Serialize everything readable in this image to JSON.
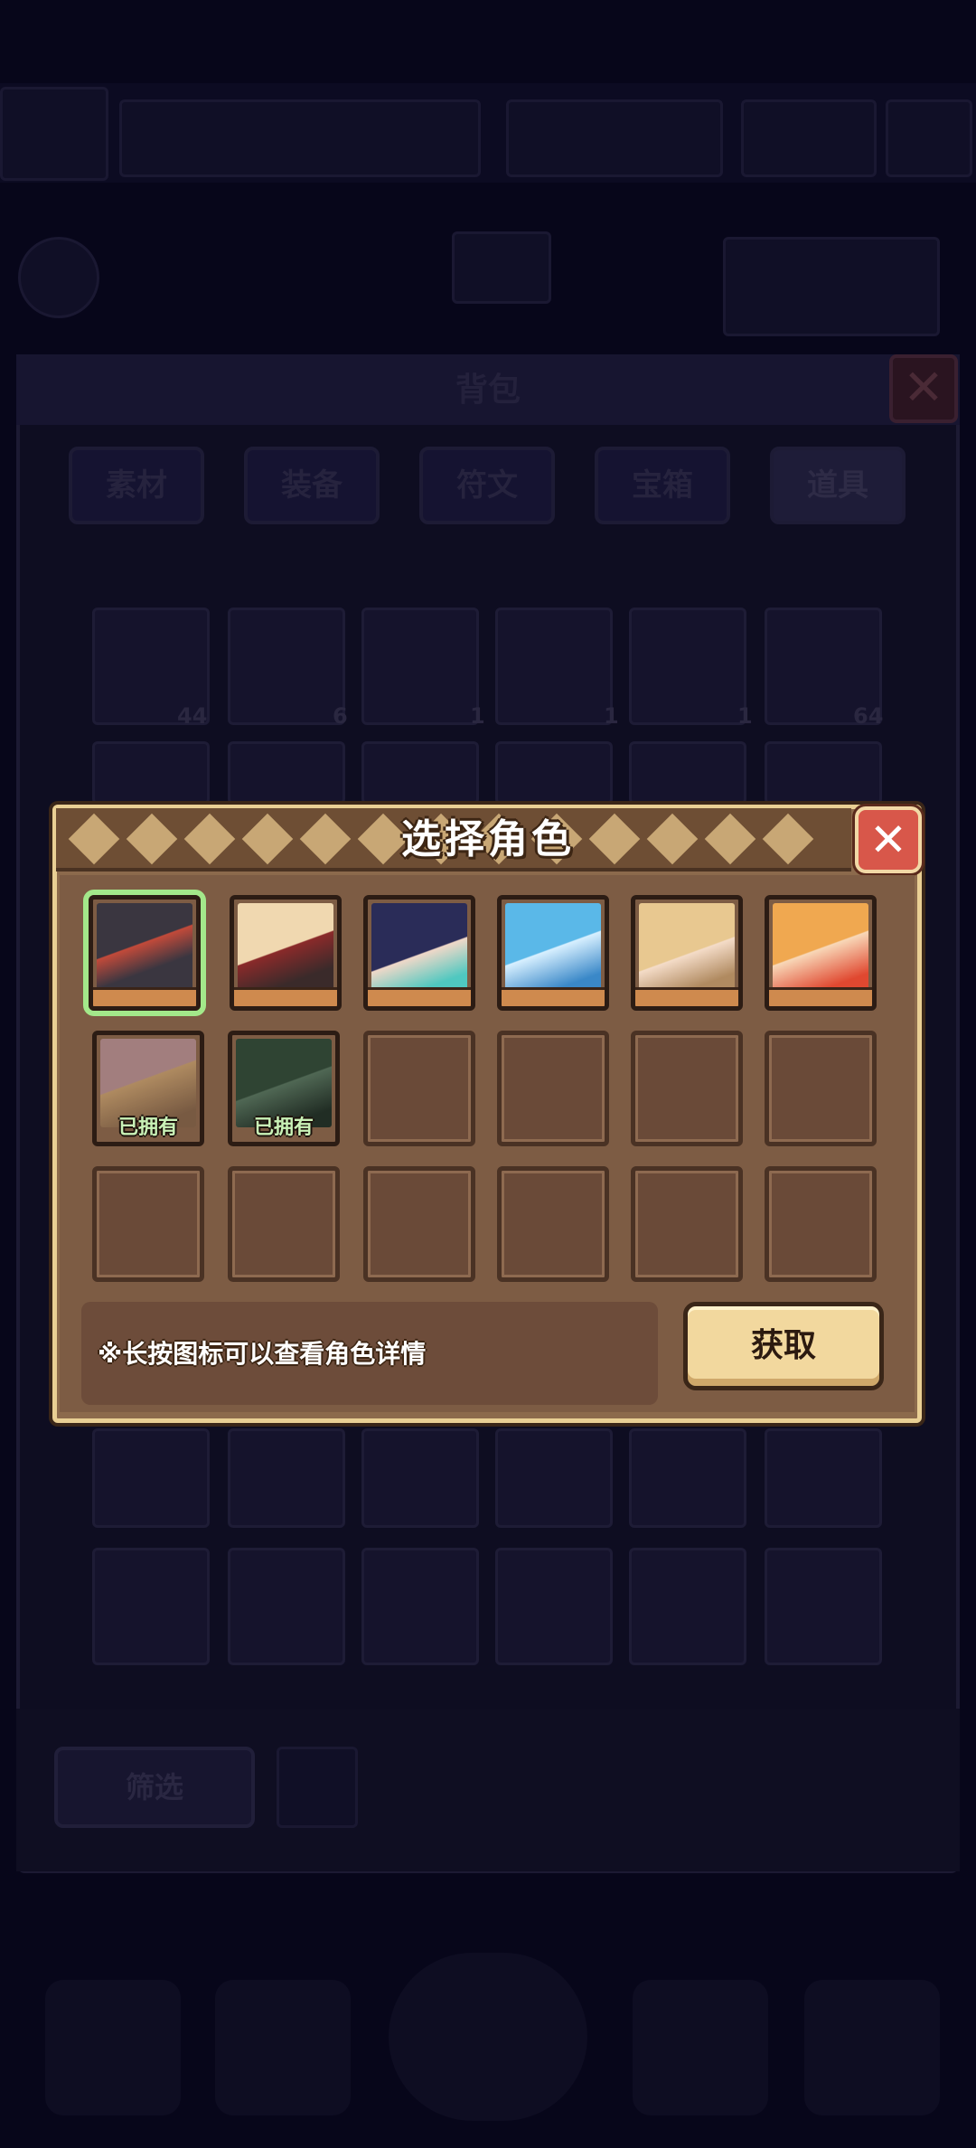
{
  "background": {
    "panel_title": "背包",
    "tabs": [
      "素材",
      "装备",
      "符文",
      "宝箱",
      "道具"
    ],
    "slot_counts": [
      "44",
      "6",
      "1",
      "1",
      "1",
      "64"
    ],
    "filter_label": "筛选"
  },
  "dialog": {
    "title": "选择角色",
    "hint": "※长按图标可以查看角色详情",
    "get_button": "获取",
    "owned_label": "已拥有",
    "characters": [
      {
        "name": "dark-hair-girl",
        "selected": true,
        "owned": false,
        "colors": [
          "#3a3640",
          "#c24a3a"
        ]
      },
      {
        "name": "blonde-horn-girl",
        "selected": false,
        "owned": false,
        "colors": [
          "#f0d8b0",
          "#8a2a2a"
        ]
      },
      {
        "name": "navy-hair-girl",
        "selected": false,
        "owned": false,
        "colors": [
          "#2a2c58",
          "#4fc8c0"
        ]
      },
      {
        "name": "blue-hair-girl",
        "selected": false,
        "owned": false,
        "colors": [
          "#5ab8e8",
          "#d8f0ff"
        ]
      },
      {
        "name": "golden-hair-girl",
        "selected": false,
        "owned": false,
        "colors": [
          "#e8c890",
          "#b08a60"
        ]
      },
      {
        "name": "orange-hair-girl",
        "selected": false,
        "owned": false,
        "colors": [
          "#f0a850",
          "#e04830"
        ]
      },
      {
        "name": "pink-hat-girl",
        "selected": false,
        "owned": true,
        "colors": [
          "#d8a8a8",
          "#e8b880"
        ]
      },
      {
        "name": "green-hair-girl",
        "selected": false,
        "owned": true,
        "colors": [
          "#3e5a44",
          "#6a8a70"
        ]
      }
    ]
  },
  "colors": {
    "accent_green": "#a3e88a",
    "close_red": "#d8574a",
    "button_gold": "#f2d89e"
  }
}
